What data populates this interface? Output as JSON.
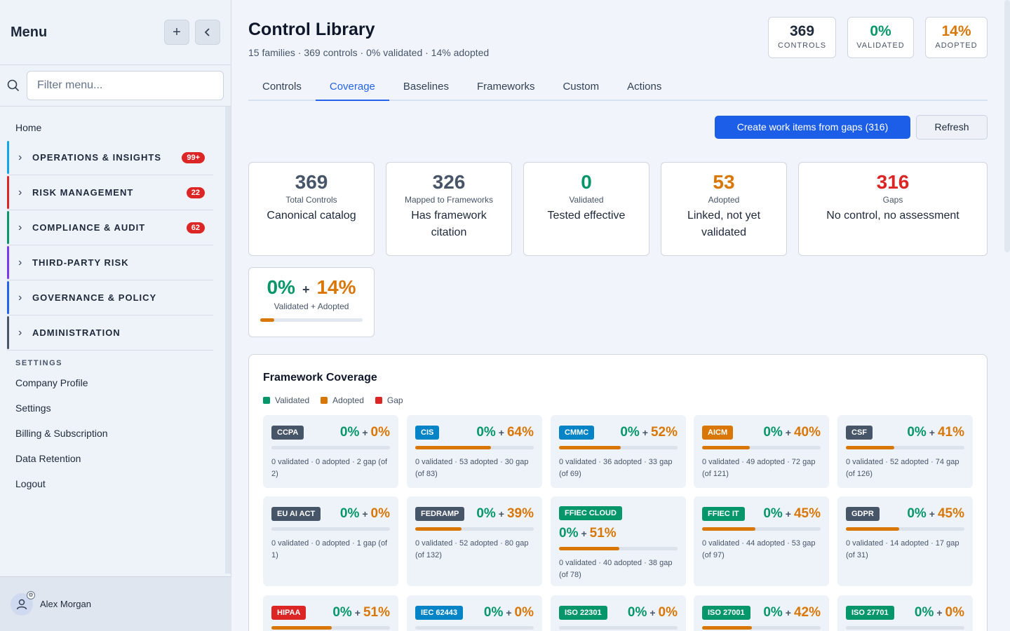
{
  "sidebar": {
    "title": "Menu",
    "filter_placeholder": "Filter menu...",
    "home": "Home",
    "groups": [
      {
        "label": "OPERATIONS & INSIGHTS",
        "badge": "99+",
        "color": "#0ea5e9"
      },
      {
        "label": "RISK MANAGEMENT",
        "badge": "22",
        "color": "#dc2626"
      },
      {
        "label": "COMPLIANCE & AUDIT",
        "badge": "62",
        "color": "#059669"
      },
      {
        "label": "THIRD-PARTY RISK",
        "badge": "",
        "color": "#7c3aed"
      },
      {
        "label": "GOVERNANCE & POLICY",
        "badge": "",
        "color": "#2563eb"
      },
      {
        "label": "ADMINISTRATION",
        "badge": "",
        "color": "#475569"
      }
    ],
    "settings_heading": "SETTINGS",
    "settings_items": [
      "Company Profile",
      "Settings",
      "Billing & Subscription",
      "Data Retention",
      "Logout"
    ],
    "user_name": "Alex Morgan"
  },
  "header": {
    "title": "Control Library",
    "subtitle": "15 families · 369 controls · 0% validated · 14% adopted",
    "kpis": [
      {
        "value": "369",
        "label": "CONTROLS",
        "color": "#1e293b"
      },
      {
        "value": "0%",
        "label": "VALIDATED",
        "color": "#059669"
      },
      {
        "value": "14%",
        "label": "ADOPTED",
        "color": "#d97706"
      }
    ]
  },
  "tabs": [
    "Controls",
    "Coverage",
    "Baselines",
    "Frameworks",
    "Custom",
    "Actions"
  ],
  "active_tab": "Coverage",
  "actions": {
    "primary": "Create work items from gaps (316)",
    "secondary": "Refresh"
  },
  "stats": [
    {
      "value": "369",
      "label": "Total Controls",
      "desc": "Canonical catalog",
      "color": "#475569"
    },
    {
      "value": "326",
      "label": "Mapped to Frameworks",
      "desc": "Has framework citation",
      "color": "#475569"
    },
    {
      "value": "0",
      "label": "Validated",
      "desc": "Tested effective",
      "color": "#059669"
    },
    {
      "value": "53",
      "label": "Adopted",
      "desc": "Linked, not yet validated",
      "color": "#d97706"
    },
    {
      "value": "316",
      "label": "Gaps",
      "desc": "No control, no assessment",
      "color": "#dc2626"
    }
  ],
  "combined": {
    "validated": "0%",
    "plus": "+",
    "adopted": "14%",
    "label": "Validated + Adopted",
    "adopted_fraction": 0.14
  },
  "framework_coverage": {
    "title": "Framework Coverage",
    "legend": [
      {
        "label": "Validated",
        "color": "#059669"
      },
      {
        "label": "Adopted",
        "color": "#d97706"
      },
      {
        "label": "Gap",
        "color": "#dc2626"
      }
    ],
    "frameworks": [
      {
        "tag": "CCPA",
        "tag_color": "#475569",
        "validated": "0%",
        "adopted": "0%",
        "adopted_fraction": 0.0,
        "meta": "0 validated · 0 adopted · 2 gap (of 2)"
      },
      {
        "tag": "CIS",
        "tag_color": "#0284c7",
        "validated": "0%",
        "adopted": "64%",
        "adopted_fraction": 0.64,
        "meta": "0 validated · 53 adopted · 30 gap (of 83)"
      },
      {
        "tag": "CMMC",
        "tag_color": "#0284c7",
        "validated": "0%",
        "adopted": "52%",
        "adopted_fraction": 0.52,
        "meta": "0 validated · 36 adopted · 33 gap (of 69)"
      },
      {
        "tag": "AICM",
        "tag_color": "#d97706",
        "validated": "0%",
        "adopted": "40%",
        "adopted_fraction": 0.4,
        "meta": "0 validated · 49 adopted · 72 gap (of 121)"
      },
      {
        "tag": "CSF",
        "tag_color": "#475569",
        "validated": "0%",
        "adopted": "41%",
        "adopted_fraction": 0.41,
        "meta": "0 validated · 52 adopted · 74 gap (of 126)"
      },
      {
        "tag": "EU AI ACT",
        "tag_color": "#475569",
        "validated": "0%",
        "adopted": "0%",
        "adopted_fraction": 0.0,
        "meta": "0 validated · 0 adopted · 1 gap (of 1)"
      },
      {
        "tag": "FEDRAMP",
        "tag_color": "#475569",
        "validated": "0%",
        "adopted": "39%",
        "adopted_fraction": 0.39,
        "meta": "0 validated · 52 adopted · 80 gap (of 132)"
      },
      {
        "tag": "FFIEC CLOUD",
        "tag_color": "#059669",
        "validated": "0%",
        "adopted": "51%",
        "adopted_fraction": 0.51,
        "meta": "0 validated · 40 adopted · 38 gap (of 78)"
      },
      {
        "tag": "FFIEC IT",
        "tag_color": "#059669",
        "validated": "0%",
        "adopted": "45%",
        "adopted_fraction": 0.45,
        "meta": "0 validated · 44 adopted · 53 gap (of 97)"
      },
      {
        "tag": "GDPR",
        "tag_color": "#475569",
        "validated": "0%",
        "adopted": "45%",
        "adopted_fraction": 0.45,
        "meta": "0 validated · 14 adopted · 17 gap (of 31)"
      },
      {
        "tag": "HIPAA",
        "tag_color": "#dc2626",
        "validated": "0%",
        "adopted": "51%",
        "adopted_fraction": 0.51,
        "meta": ""
      },
      {
        "tag": "IEC 62443",
        "tag_color": "#0284c7",
        "validated": "0%",
        "adopted": "0%",
        "adopted_fraction": 0.0,
        "meta": ""
      },
      {
        "tag": "ISO 22301",
        "tag_color": "#059669",
        "validated": "0%",
        "adopted": "0%",
        "adopted_fraction": 0.0,
        "meta": ""
      },
      {
        "tag": "ISO 27001",
        "tag_color": "#059669",
        "validated": "0%",
        "adopted": "42%",
        "adopted_fraction": 0.42,
        "meta": ""
      },
      {
        "tag": "ISO 27701",
        "tag_color": "#059669",
        "validated": "0%",
        "adopted": "0%",
        "adopted_fraction": 0.0,
        "meta": ""
      }
    ]
  }
}
